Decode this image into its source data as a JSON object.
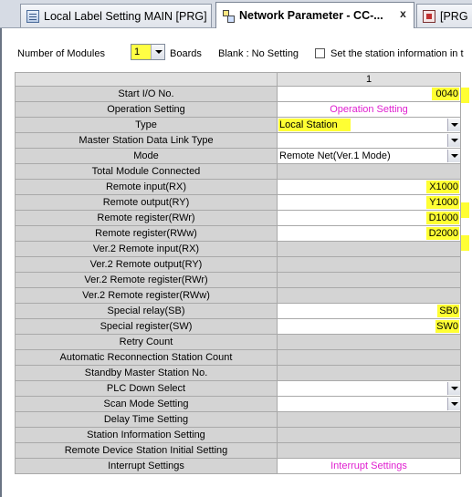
{
  "tabs": [
    {
      "label": "Local Label Setting MAIN [PRG]",
      "icon": "label-sheet-icon"
    },
    {
      "label": "Network Parameter - CC-...",
      "icon": "network-parameter-icon",
      "close": "x"
    },
    {
      "label": "[PRG",
      "icon": "program-icon"
    }
  ],
  "settings": {
    "modules_label": "Number of Modules",
    "modules_value": "1",
    "boards_label": "Boards",
    "blank_label": "Blank : No Setting",
    "station_info_label": "Set the station information in t"
  },
  "grid": {
    "column_header": "1",
    "rows": [
      {
        "name": "Start I/O No.",
        "value": "0040"
      },
      {
        "name": "Operation Setting",
        "value": "Operation Setting"
      },
      {
        "name": "Type",
        "value": "Local Station"
      },
      {
        "name": "Master Station Data Link Type",
        "value": ""
      },
      {
        "name": "Mode",
        "value": "Remote Net(Ver.1 Mode)"
      },
      {
        "name": "Total Module Connected",
        "value": ""
      },
      {
        "name": "Remote input(RX)",
        "value": "X1000"
      },
      {
        "name": "Remote output(RY)",
        "value": "Y1000"
      },
      {
        "name": "Remote register(RWr)",
        "value": "D1000"
      },
      {
        "name": "Remote register(RWw)",
        "value": "D2000"
      },
      {
        "name": "Ver.2 Remote input(RX)",
        "value": ""
      },
      {
        "name": "Ver.2 Remote output(RY)",
        "value": ""
      },
      {
        "name": "Ver.2 Remote register(RWr)",
        "value": ""
      },
      {
        "name": "Ver.2 Remote register(RWw)",
        "value": ""
      },
      {
        "name": "Special relay(SB)",
        "value": "SB0"
      },
      {
        "name": "Special register(SW)",
        "value": "SW0"
      },
      {
        "name": "Retry Count",
        "value": ""
      },
      {
        "name": "Automatic Reconnection Station Count",
        "value": ""
      },
      {
        "name": "Standby Master Station No.",
        "value": ""
      },
      {
        "name": "PLC Down Select",
        "value": ""
      },
      {
        "name": "Scan Mode Setting",
        "value": ""
      },
      {
        "name": "Delay Time Setting",
        "value": ""
      },
      {
        "name": "Station Information Setting",
        "value": ""
      },
      {
        "name": "Remote Device Station Initial Setting",
        "value": ""
      },
      {
        "name": "Interrupt Settings",
        "value": "Interrupt Settings"
      }
    ]
  },
  "colors": {
    "highlight": "#ffff33",
    "link_text": "#e020d0",
    "cell_gray": "#d4d4d4"
  }
}
